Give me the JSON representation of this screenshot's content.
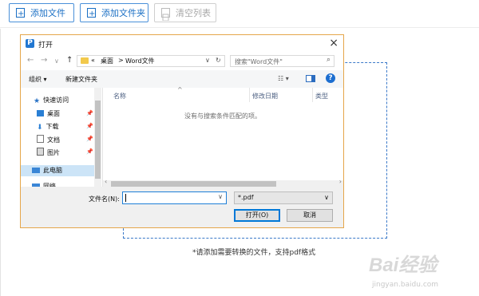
{
  "toolbar": {
    "add_file": "添加文件",
    "add_folder": "添加文件夹",
    "clear_list": "清空列表"
  },
  "hint": "*请添加需要转换的文件，支持pdf格式",
  "watermark": {
    "brand": "Bai经验",
    "url": "jingyan.baidu.com"
  },
  "dialog": {
    "title": "打开",
    "breadcrumb": [
      "«",
      "桌面",
      ">",
      "Word文件"
    ],
    "search_placeholder": "搜索\"Word文件\"",
    "commands": {
      "organize": "组织 ▾",
      "new_folder": "新建文件夹"
    },
    "nav_items": [
      {
        "label": "快速访问",
        "icon": "star-icon"
      },
      {
        "label": "桌面",
        "icon": "desktop-icon",
        "pinned": true
      },
      {
        "label": "下载",
        "icon": "download-icon",
        "pinned": true
      },
      {
        "label": "文档",
        "icon": "document-icon",
        "pinned": true
      },
      {
        "label": "图片",
        "icon": "picture-icon",
        "pinned": true
      },
      {
        "label": "此电脑",
        "icon": "computer-icon"
      },
      {
        "label": "网络",
        "icon": "network-icon"
      }
    ],
    "columns": {
      "name": "名称",
      "modified": "修改日期",
      "type": "类型"
    },
    "empty_message": "没有与搜索条件匹配的项。",
    "filename_label": "文件名(N):",
    "filename_value": "",
    "filter": "*.pdf",
    "open_button": "打开(O)",
    "cancel_button": "取消"
  },
  "colors": {
    "accent": "#1a6fc4",
    "dialog_border": "#e5a64a",
    "dashed_border": "#3b79c9"
  }
}
